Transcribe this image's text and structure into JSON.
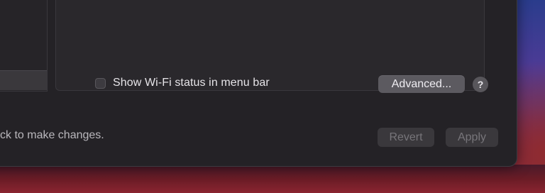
{
  "wifi": {
    "show_status_label": "Show Wi-Fi status in menu bar",
    "show_status_checked": false,
    "advanced_label": "Advanced...",
    "help_label": "?"
  },
  "footer": {
    "lock_message": "ck to make changes.",
    "revert_label": "Revert",
    "apply_label": "Apply"
  },
  "colors": {
    "window_bg": "#242226",
    "button_bg": "#5c5a60",
    "disabled_text": "#77757a"
  }
}
